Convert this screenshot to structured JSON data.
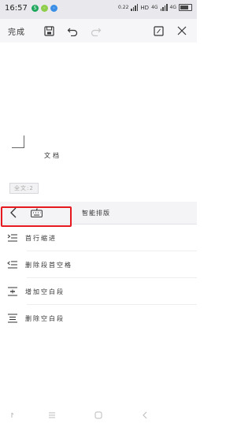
{
  "status_bar": {
    "time": "16:57",
    "speed": "0.22",
    "network": "HD",
    "network2": "4G",
    "wifi_label": "4G"
  },
  "toolbar": {
    "done_label": "完成"
  },
  "document": {
    "text": "文档"
  },
  "wordcount": {
    "label": "全文:2"
  },
  "panel": {
    "title": "智能排版"
  },
  "menu": {
    "items": [
      {
        "label": "首行缩进",
        "icon": "first-line-indent-icon"
      },
      {
        "label": "删除段首空格",
        "icon": "remove-leading-space-icon"
      },
      {
        "label": "增加空白段",
        "icon": "add-blank-paragraph-icon"
      },
      {
        "label": "删除空白段",
        "icon": "remove-blank-paragraph-icon"
      }
    ]
  },
  "colors": {
    "highlight": "#e5191e",
    "toolbar_bg": "#f6f6f8",
    "status_bg": "#e9e9ed"
  }
}
